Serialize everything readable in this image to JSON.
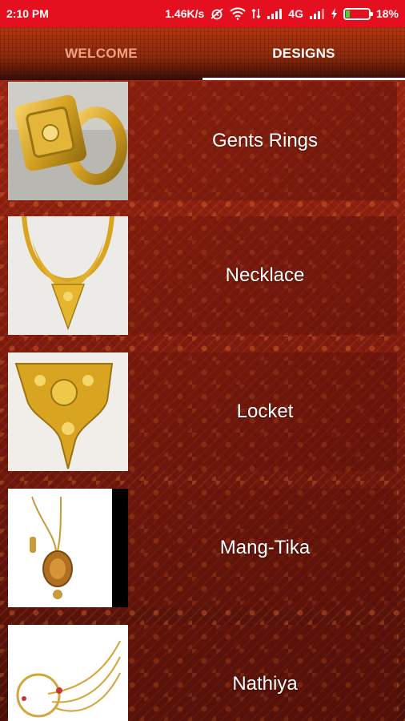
{
  "status_bar": {
    "time": "2:10 PM",
    "net_speed": "1.46K/s",
    "network_type": "4G",
    "battery_percent": "18%",
    "icons": [
      "alarm-off-icon",
      "wifi-icon",
      "data-arrows-icon",
      "signal-icon",
      "signal-icon-2",
      "charging-icon",
      "battery-icon"
    ]
  },
  "tabs": [
    {
      "label": "WELCOME",
      "selected": false
    },
    {
      "label": "DESIGNS",
      "selected": true
    }
  ],
  "designs": [
    {
      "label": "Gents Rings",
      "image": "gold-ring"
    },
    {
      "label": "Necklace",
      "image": "gold-necklace"
    },
    {
      "label": "Locket",
      "image": "gold-locket"
    },
    {
      "label": "Mang-Tika",
      "image": "mang-tika"
    },
    {
      "label": "Nathiya",
      "image": "nathiya"
    }
  ],
  "colors": {
    "status_bar": "#e5101f",
    "tab_selected_text": "#ffffff",
    "tab_unselected_text": "#f1a081",
    "background": "#7a1a0e",
    "gold": "#d9a520"
  }
}
